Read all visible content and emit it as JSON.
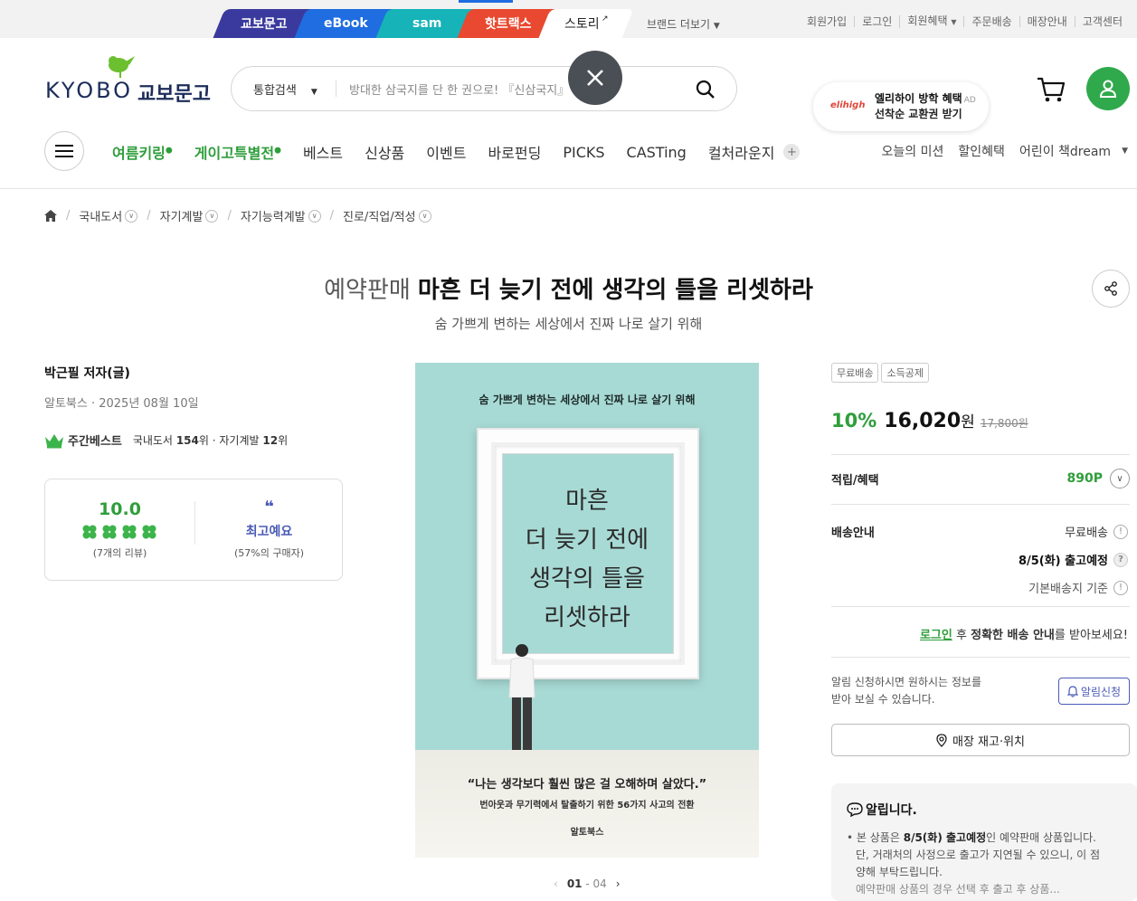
{
  "topbar": {
    "tabs": [
      {
        "label": "교보문고",
        "color": "#3a3a9e"
      },
      {
        "label": "eBook",
        "color": "#1f6de0"
      },
      {
        "label": "sam",
        "color": "#16b3b8"
      },
      {
        "label": "핫트랙스",
        "color": "#e84930"
      },
      {
        "label": "스토리",
        "color": "#ffffff"
      }
    ],
    "brand_more": "브랜드 더보기",
    "util_links": [
      "회원가입",
      "로그인",
      "회원혜택",
      "주문배송",
      "매장안내",
      "고객센터"
    ]
  },
  "header": {
    "logo_word": "KYOBO",
    "logo_kr": "교보문고",
    "search_category": "통합검색",
    "search_placeholder": "방대한 삼국지를 단 한 권으로! 『신삼국지』",
    "ad_brand": "elihigh",
    "ad_title": "엘리하이 방학 혜택",
    "ad_tag": "AD",
    "ad_sub": "선착순 교환권 받기"
  },
  "gnb": {
    "items": [
      "여름키링",
      "게이고특별전",
      "베스트",
      "신상품",
      "이벤트",
      "바로펀딩",
      "PICKS",
      "CASTing",
      "컬처라운지"
    ],
    "right_items": [
      "오늘의 미션",
      "할인혜택",
      "어린이 책dream"
    ]
  },
  "breadcrumb": [
    "국내도서",
    "자기계발",
    "자기능력계발",
    "진로/직업/적성"
  ],
  "product": {
    "prefix": "예약판매",
    "title": "마흔 더 늦기 전에 생각의 틀을 리셋하라",
    "subtitle": "숨 가쁘게 변하는 세상에서 진짜 나로 살기 위해",
    "author": "박근필 저자(글)",
    "publisher_date": "알토북스 · 2025년 08월 10일",
    "best_label": "주간베스트",
    "rank_text_1": "국내도서",
    "rank_1": "154",
    "rank_text_2": "위 · 자기계발",
    "rank_2": "12",
    "rank_suffix": "위",
    "rating": "10.0",
    "rating_count": "(7개의 리뷰)",
    "review_label": "최고예요",
    "review_pct": "(57%의 구매자)",
    "clover_count": 4,
    "pager_current": "01",
    "pager_total": "- 04"
  },
  "cover": {
    "top_line": "숨 가쁘게 변하는 세상에서 진짜 나로 살기 위해",
    "title_lines": [
      "마흔",
      "더 늦기 전에",
      "생각의 틀을",
      "리셋하라"
    ],
    "quote": "“나는 생각보다 훨씬 많은 걸 오해하며 살았다.”",
    "quote_sub": "번아웃과 무기력에서 탈출하기 위한 56가지 사고의 전환",
    "publisher": "알토북스"
  },
  "purchase": {
    "badges": [
      "무료배송",
      "소득공제"
    ],
    "discount": "10%",
    "price": "16,020",
    "price_unit": "원",
    "original_price": "17,800원",
    "points_label": "적립/혜택",
    "points_value": "890P",
    "delivery_label": "배송안내",
    "delivery_free": "무료배송",
    "delivery_date": "8/5(화) 출고예정",
    "delivery_basis": "기본배송지 기준",
    "login_link": "로그인",
    "login_text_1": "후",
    "login_bold": "정확한 배송 안내",
    "login_text_2": "를 받아보세요!",
    "alert_text_1": "알림 신청하시면 원하시는 정보를",
    "alert_text_2": "받아 보실 수 있습니다.",
    "alert_button": "알림신청",
    "store_button": "매장 재고·위치",
    "notice_title": "알립니다.",
    "notice_body_1": "본 상품은",
    "notice_bold": "8/5(화) 출고예정",
    "notice_body_2": "인 예약판매 상품입니다.",
    "notice_line_2": "단, 거래처의 사정으로 출고가 지연될 수 있으니, 이 점",
    "notice_line_3": "양해 부탁드립니다.",
    "notice_line_4": "예약판매 상품의 경우 선택 후 출고 후 상품..."
  },
  "colors": {
    "brand_green": "#2f9e3c",
    "navy": "#1c2d5a",
    "accent_blue": "#4a5bb6"
  }
}
